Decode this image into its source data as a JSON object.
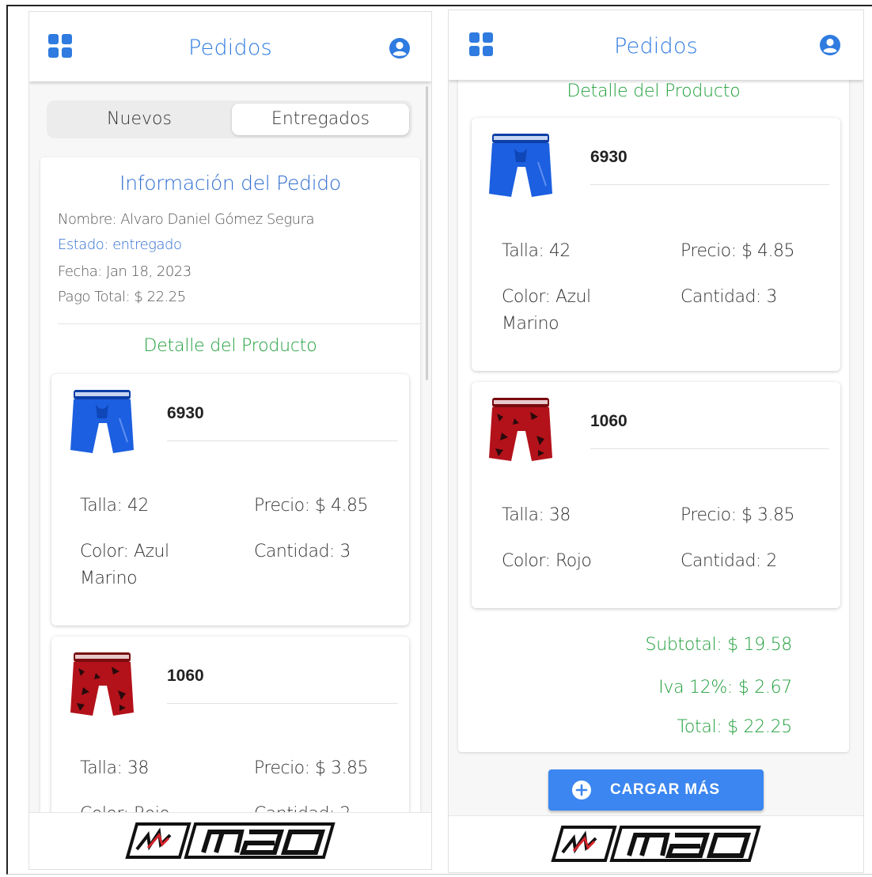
{
  "app": {
    "title": "Pedidos",
    "brand": "MAO",
    "accent_color": "#2f7be0",
    "green_color": "#1f9e3a"
  },
  "tabs": [
    {
      "label": "Nuevos",
      "selected": false
    },
    {
      "label": "Entregados",
      "selected": true
    }
  ],
  "order": {
    "heading": "Información del Pedido",
    "nombre": "Nombre: Alvaro Daniel Gómez Segura",
    "estado": "Estado: entregado",
    "fecha": "Fecha: Jan 18, 2023",
    "pago_total": "Pago Total: $ 22.25"
  },
  "detail_heading": "Detalle del Producto",
  "products": [
    {
      "code": "6930",
      "talla": "Talla: 42",
      "precio": "Precio: $ 4.85",
      "color_line1": "Color: Azul",
      "color_line2": "Marino",
      "cantidad": "Cantidad: 3",
      "image": "blue-boxer-brief-icon",
      "image_color": "#1c5fe0"
    },
    {
      "code": "1060",
      "talla": "Talla: 38",
      "precio": "Precio: $ 3.85",
      "color_line1": "Color: Rojo",
      "cantidad": "Cantidad: 2",
      "image": "red-camo-boxer-brief-icon",
      "image_color": "#b3121a"
    }
  ],
  "partial": {
    "color": "Color: Rojo",
    "cantidad": "Cantidad: 2"
  },
  "totals": {
    "subtotal": "Subtotal: $  19.58",
    "iva": "Iva 12%: $  2.67",
    "total": "Total: $  22.25"
  },
  "load_more_label": "CARGAR MÁS",
  "icons": {
    "menu": "grid-icon",
    "profile": "user-circle-icon",
    "add": "plus-circle-icon"
  }
}
